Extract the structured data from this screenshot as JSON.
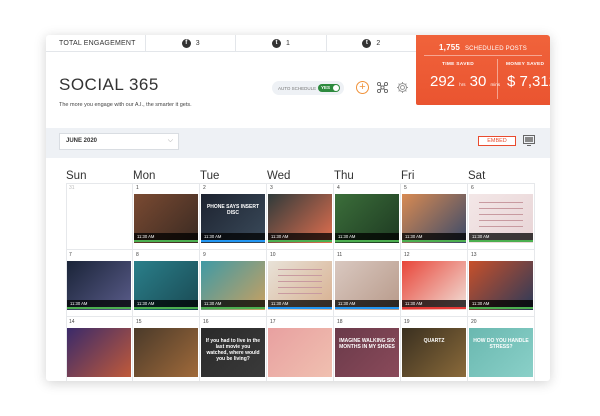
{
  "engagement": {
    "title": "TOTAL ENGAGEMENT",
    "items": [
      {
        "icon": "facebook-icon",
        "glyph": "f",
        "count": "3"
      },
      {
        "icon": "twitter-icon",
        "glyph": "t",
        "count": "1"
      },
      {
        "icon": "tumblr-icon",
        "glyph": "t",
        "count": "2"
      }
    ]
  },
  "app": {
    "title": "SOCIAL 365",
    "subtitle": "The more you engage with our A.I., the smarter it gets."
  },
  "autoschedule": {
    "label": "AUTO SCHEDULE",
    "toggle": "YES"
  },
  "stats": {
    "scheduled_count": "1,755",
    "scheduled_label": "SCHEDULED POSTS",
    "time_label": "TIME SAVED",
    "time_hours": "292",
    "time_hours_unit": "hrs",
    "time_mins": "30",
    "time_mins_unit": "mins",
    "money_label": "MONEY SAVED",
    "money_currency": "$",
    "money_value": "7,312"
  },
  "toolbar": {
    "month": "JUNE 2020",
    "embed": "EMBED"
  },
  "weekdays": [
    "Sun",
    "Mon",
    "Tue",
    "Wed",
    "Thu",
    "Fri",
    "Sat"
  ],
  "colors": {
    "accent": "#ea5430",
    "green": "#4caf50",
    "blue": "#2196f3",
    "red": "#e53935"
  },
  "calendar": {
    "cells": [
      {
        "day": "31",
        "faded": true
      },
      {
        "day": "1",
        "time": "11:30 AM",
        "bar": "green",
        "art": [
          "#7a4a32",
          "#3a2a22"
        ]
      },
      {
        "day": "2",
        "time": "11:30 AM",
        "bar": "blue",
        "art": [
          "#1d2330",
          "#3a4a5a"
        ],
        "caption": "PHONE SAYS INSERT DISC"
      },
      {
        "day": "3",
        "time": "11:30 AM",
        "bar": "green",
        "art": [
          "#2f3a3a",
          "#e36f4f"
        ]
      },
      {
        "day": "4",
        "time": "11:30 AM",
        "bar": "green",
        "art": [
          "#3b6e3a",
          "#1e3a22"
        ]
      },
      {
        "day": "5",
        "time": "11:30 AM",
        "bar": "green",
        "art": [
          "#d88a52",
          "#3a4a6a"
        ]
      },
      {
        "day": "6",
        "time": "11:30 AM",
        "bar": "green",
        "art": [
          "#f3e7e7",
          "#e8d4d6"
        ],
        "light": true
      },
      {
        "day": "7",
        "time": "11:30 AM",
        "bar": "green",
        "art": [
          "#1a2438",
          "#5a5c8a"
        ]
      },
      {
        "day": "8",
        "time": "11:30 AM",
        "bar": "green",
        "art": [
          "#2a7f8a",
          "#1a4a54"
        ]
      },
      {
        "day": "9",
        "time": "11:30 AM",
        "bar": "green",
        "art": [
          "#3f9aa5",
          "#c9a060"
        ]
      },
      {
        "day": "10",
        "time": "11:30 AM",
        "bar": "blue",
        "art": [
          "#e8e2d8",
          "#d8b090"
        ],
        "light": true
      },
      {
        "day": "11",
        "time": "11:30 AM",
        "bar": "blue",
        "art": [
          "#d9c8c0",
          "#b89a8a"
        ]
      },
      {
        "day": "12",
        "time": "11:30 AM",
        "bar": "red",
        "art": [
          "#e8463a",
          "#f1e0d8"
        ]
      },
      {
        "day": "13",
        "time": "11:30 AM",
        "bar": "green",
        "art": [
          "#c8502a",
          "#2a3a5a"
        ]
      },
      {
        "day": "14",
        "art": [
          "#3a2a6a",
          "#c05a3a"
        ]
      },
      {
        "day": "15",
        "art": [
          "#4a3a2a",
          "#a06a3a"
        ]
      },
      {
        "day": "16",
        "art": [
          "#2a2a2a",
          "#3a3a3a"
        ],
        "caption": "If you had to live in the last movie you watched, where would you be living?"
      },
      {
        "day": "17",
        "art": [
          "#e8a0a0",
          "#f0c0b0"
        ]
      },
      {
        "day": "18",
        "art": [
          "#6a3a4a",
          "#8a4a5a"
        ],
        "caption": "IMAGINE WALKING SIX MONTHS IN MY SHOES"
      },
      {
        "day": "19",
        "art": [
          "#3a3020",
          "#8a6a3a"
        ],
        "caption": "QUARTZ"
      },
      {
        "day": "20",
        "art": [
          "#6ab8b0",
          "#8ad0c8"
        ],
        "caption": "HOW DO YOU HANDLE STRESS?"
      }
    ]
  }
}
